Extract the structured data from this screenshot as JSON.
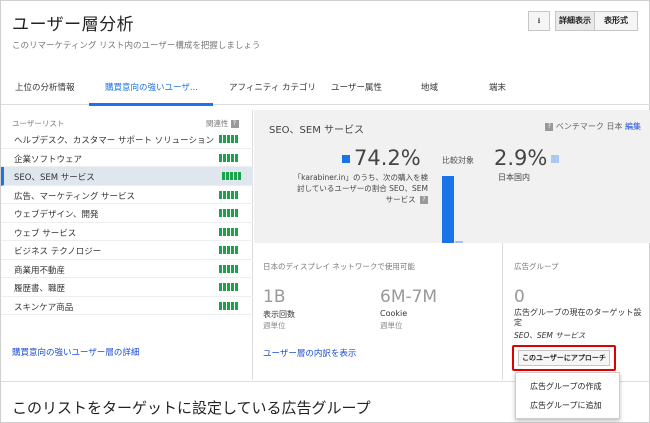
{
  "header": {
    "title": "ユーザー層分析",
    "subtitle": "このリマーケティング リスト内のユーザー構成を把握しましょう",
    "download_icon": "download-icon",
    "detail_label": "詳細表示",
    "table_label": "表形式"
  },
  "tabs": [
    {
      "label": "上位の分析情報"
    },
    {
      "label": "購買意向の強いユーザ..."
    },
    {
      "label": "アフィニティ カテゴリ"
    },
    {
      "label": "ユーザー属性"
    },
    {
      "label": "地域"
    },
    {
      "label": "端末"
    }
  ],
  "user_list": {
    "header": "ユーザーリスト",
    "relevance_header": "関連性",
    "items": [
      {
        "label": "ヘルプデスク、カスタマー サポート ソリューション",
        "relevance": 5
      },
      {
        "label": "企業ソフトウェア",
        "relevance": 5
      },
      {
        "label": "SEO、SEM サービス",
        "relevance": 5
      },
      {
        "label": "広告、マーケティング サービス",
        "relevance": 5
      },
      {
        "label": "ウェブデザイン、開発",
        "relevance": 5
      },
      {
        "label": "ウェブ サービス",
        "relevance": 5
      },
      {
        "label": "ビジネス テクノロジー",
        "relevance": 5
      },
      {
        "label": "商業用不動産",
        "relevance": 5
      },
      {
        "label": "履歴書、職歴",
        "relevance": 5
      },
      {
        "label": "スキンケア商品",
        "relevance": 5
      }
    ],
    "selected_index": 2,
    "details_link": "購買意向の強いユーザー層の詳細"
  },
  "segment": {
    "title": "SEO、SEM サービス",
    "benchmark": "ベンチマーク 日本",
    "edit": "編集",
    "percent": "74.2%",
    "percent_desc": "「karabiner.in」のうち、次の購入を検討しているユーザーの割合 SEO、SEM サービス",
    "compare_label": "比較対象",
    "bench_percent": "2.9%",
    "bench_desc": "日本国内",
    "accent": "#1a73e8"
  },
  "network": {
    "title": "日本のディスプレイ ネットワークで使用可能",
    "impressions_value": "1B",
    "impressions_label": "表示回数",
    "impressions_sub": "週単位",
    "cookie_value": "6M-7M",
    "cookie_label": "Cookie",
    "cookie_sub": "週単位",
    "breakdown_link": "ユーザー層の内訳を表示"
  },
  "ad_group": {
    "title": "広告グループ",
    "count": "0",
    "desc": "広告グループの現在のターゲット設定",
    "sub": "SEO、SEM サービス",
    "approach_label": "このユーザーにアプローチ",
    "dropdown": [
      "広告グループの作成",
      "広告グループに追加"
    ]
  },
  "bottom": {
    "title": "このリストをターゲットに設定している広告グループ"
  }
}
